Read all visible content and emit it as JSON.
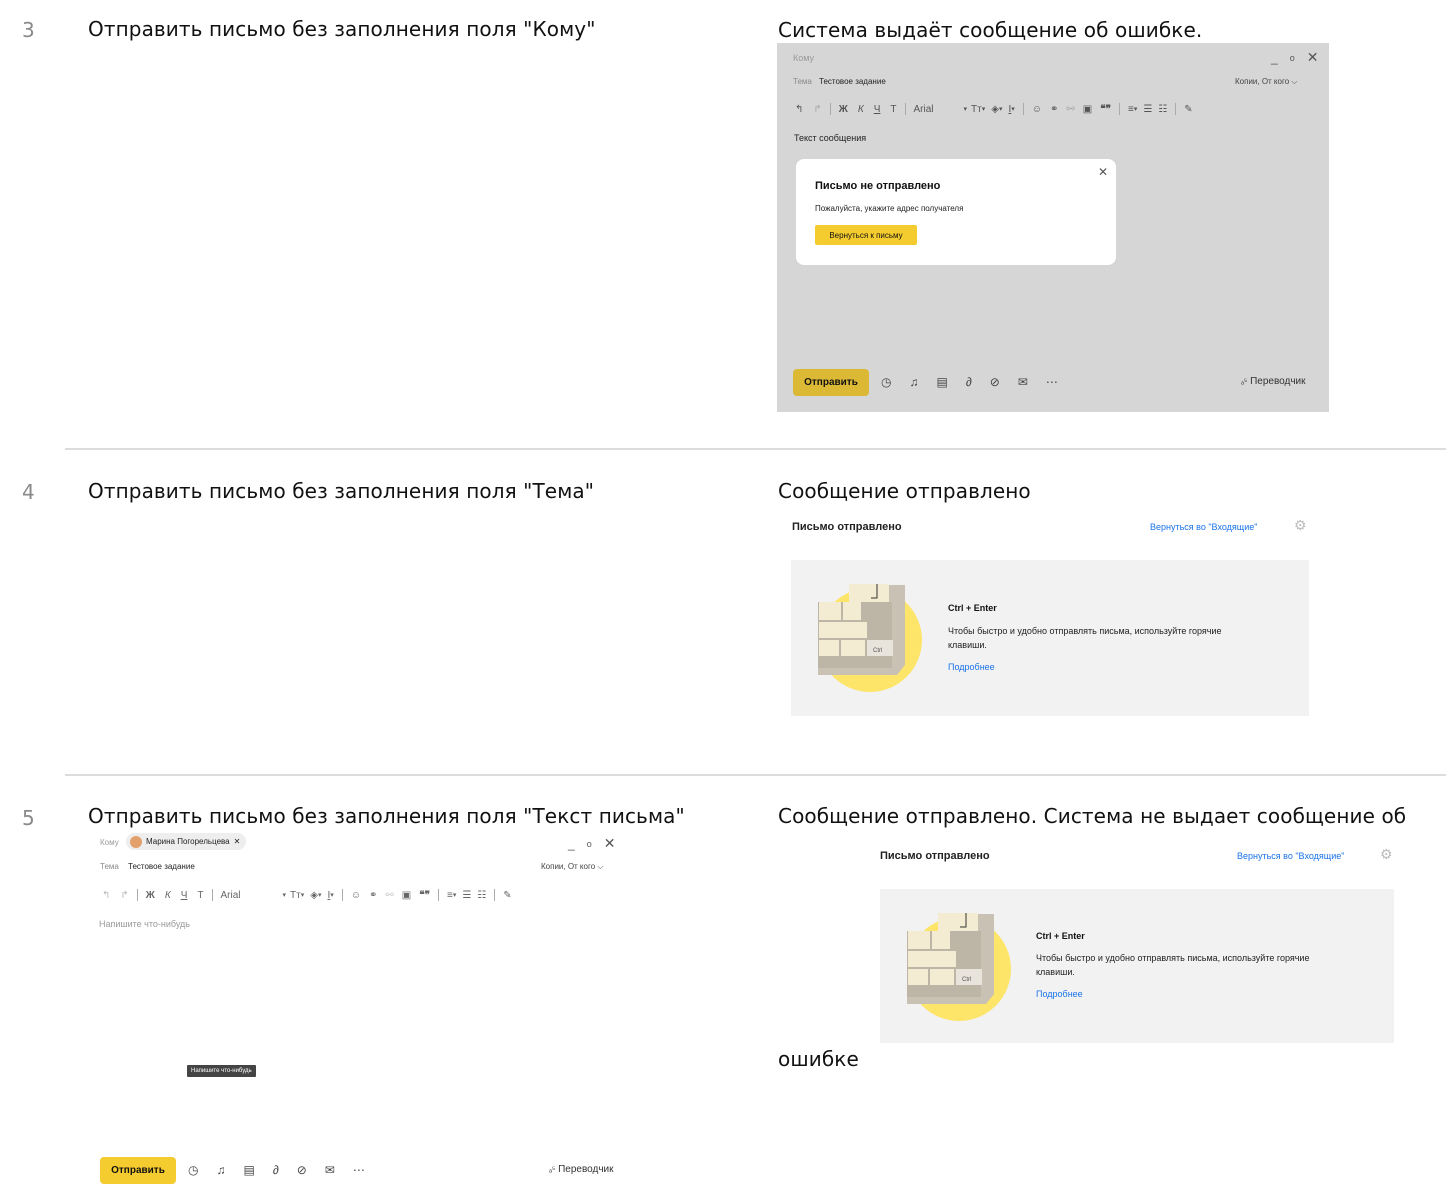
{
  "cases": [
    {
      "number": "3",
      "title": "Отправить письмо без заполнения поля \"Кому\"",
      "result": "Система выдаёт сообщение об ошибке."
    },
    {
      "number": "4",
      "title": "Отправить письмо без заполнения поля \"Тема\"",
      "result": "Сообщение отправлено"
    },
    {
      "number": "5",
      "title": "Отправить письмо без заполнения поля \"Текст письма\"",
      "result": "Сообщение отправлено. Система  не  выдает сообщение об",
      "result_cont": "ошибке"
    }
  ],
  "compose_error": {
    "to_label": "Кому",
    "subject_label": "Тема",
    "subject_value": "Тестовое задание",
    "cc_label": "Копии, От кого",
    "font_name": "Arial",
    "body_text": "Текст сообщения",
    "send_label": "Отправить",
    "translator_label": "Переводчик",
    "modal": {
      "title": "Письмо не отправлено",
      "message": "Пожалуйста, укажите адрес получателя",
      "button": "Вернуться к письму"
    },
    "backdrop_color": "#d6d6d6",
    "accent": "#f5cc30"
  },
  "compose_empty": {
    "to_label": "Кому",
    "recipient": "Марина Погорельцева",
    "subject_label": "Тема",
    "subject_value": "Тестовое задание",
    "cc_label": "Копии, От кого",
    "font_name": "Arial",
    "body_placeholder": "Напишите что-нибудь",
    "tooltip": "Напишите что-нибудь",
    "send_label": "Отправить",
    "translator_label": "Переводчик"
  },
  "sent_page": {
    "title": "Письмо отправлено",
    "back_link": "Вернуться во \"Входящие\"",
    "hint_title": "Ctrl + Enter",
    "hint_text_1": "Чтобы быстро и удобно отправлять письма, используйте горячие",
    "hint_text_2": "клавиши.",
    "hint_link": "Подробнее",
    "key_label": "Ctrl"
  },
  "toolbar": {
    "bold": "Ж",
    "italic": "К",
    "underline": "Ч",
    "strike": "Т",
    "size": "Тт",
    "quote": "❝❞"
  },
  "icons": [
    "undo-icon",
    "redo-icon",
    "clock-icon",
    "bell-icon",
    "template-icon",
    "attach-icon",
    "disk-icon",
    "envelope-icon",
    "more-icon",
    "gear-icon",
    "close-icon",
    "minimize-icon",
    "expand-icon",
    "chevron-down-icon",
    "translate-icon"
  ]
}
